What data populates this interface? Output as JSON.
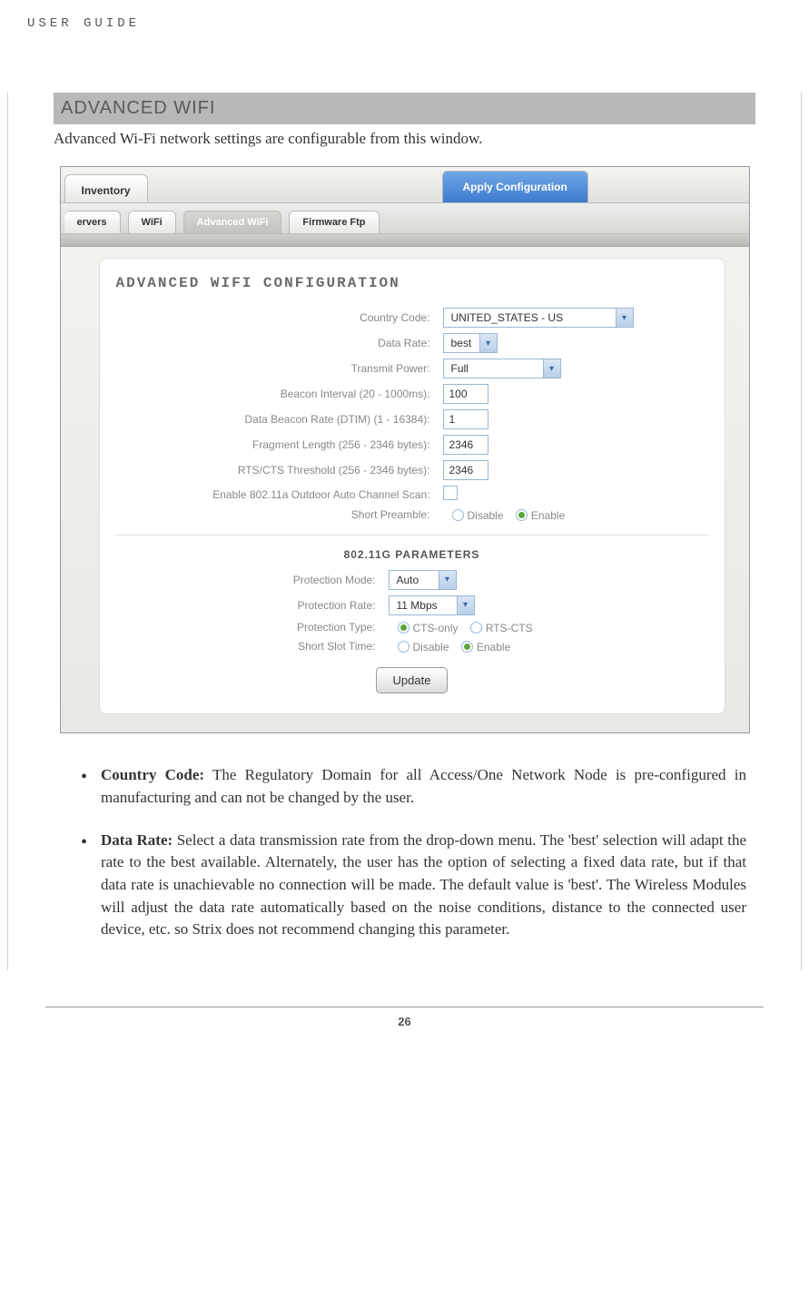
{
  "header": "USER GUIDE",
  "section": {
    "title": "ADVANCED WIFI",
    "intro": "Advanced Wi-Fi network settings are configurable from this window."
  },
  "ui": {
    "tabs_top": {
      "inventory": "Inventory",
      "apply": "Apply Configuration"
    },
    "tabs_sub": {
      "ervers": "ervers",
      "wifi": "WiFi",
      "adv": "Advanced WiFi",
      "fw": "Firmware Ftp"
    },
    "panel_title": "ADVANCED WIFI CONFIGURATION",
    "fields": {
      "country": {
        "label": "Country Code:",
        "value": "UNITED_STATES - US"
      },
      "datarate": {
        "label": "Data Rate:",
        "value": "best"
      },
      "txpower": {
        "label": "Transmit Power:",
        "value": "Full"
      },
      "beacon": {
        "label": "Beacon Interval (20 - 1000ms):",
        "value": "100"
      },
      "dtim": {
        "label": "Data Beacon Rate (DTIM) (1 - 16384):",
        "value": "1"
      },
      "frag": {
        "label": "Fragment Length (256 - 2346 bytes):",
        "value": "2346"
      },
      "rts": {
        "label": "RTS/CTS Threshold (256 - 2346 bytes):",
        "value": "2346"
      },
      "autoscan": {
        "label": "Enable 802.11a Outdoor Auto Channel Scan:"
      },
      "preamble": {
        "label": "Short Preamble:",
        "opt1": "Disable",
        "opt2": "Enable"
      }
    },
    "subpanel_title": "802.11G PARAMETERS",
    "gfields": {
      "pmode": {
        "label": "Protection Mode:",
        "value": "Auto"
      },
      "prate": {
        "label": "Protection Rate:",
        "value": "11 Mbps"
      },
      "ptype": {
        "label": "Protection Type:",
        "opt1": "CTS-only",
        "opt2": "RTS-CTS"
      },
      "slot": {
        "label": "Short Slot Time:",
        "opt1": "Disable",
        "opt2": "Enable"
      }
    },
    "update_btn": "Update"
  },
  "bullets": {
    "country_label": "Country Code:",
    "country_text": " The Regulatory Domain for all Access/One Network Node is pre-configured in manufacturing and can not be changed by the user.",
    "data_label": "Data Rate:",
    "data_text": " Select a data transmission rate from the drop-down menu. The 'best' selection will adapt the rate to the best available. Alternately, the user has the option of selecting a fixed data rate, but if that data rate is unachievable no connection will be made. The default value is 'best'. The Wireless Modules will adjust the data rate automatically based on the noise conditions, distance to the connected user device, etc. so Strix does not recommend changing this parameter."
  },
  "page_number": "26"
}
